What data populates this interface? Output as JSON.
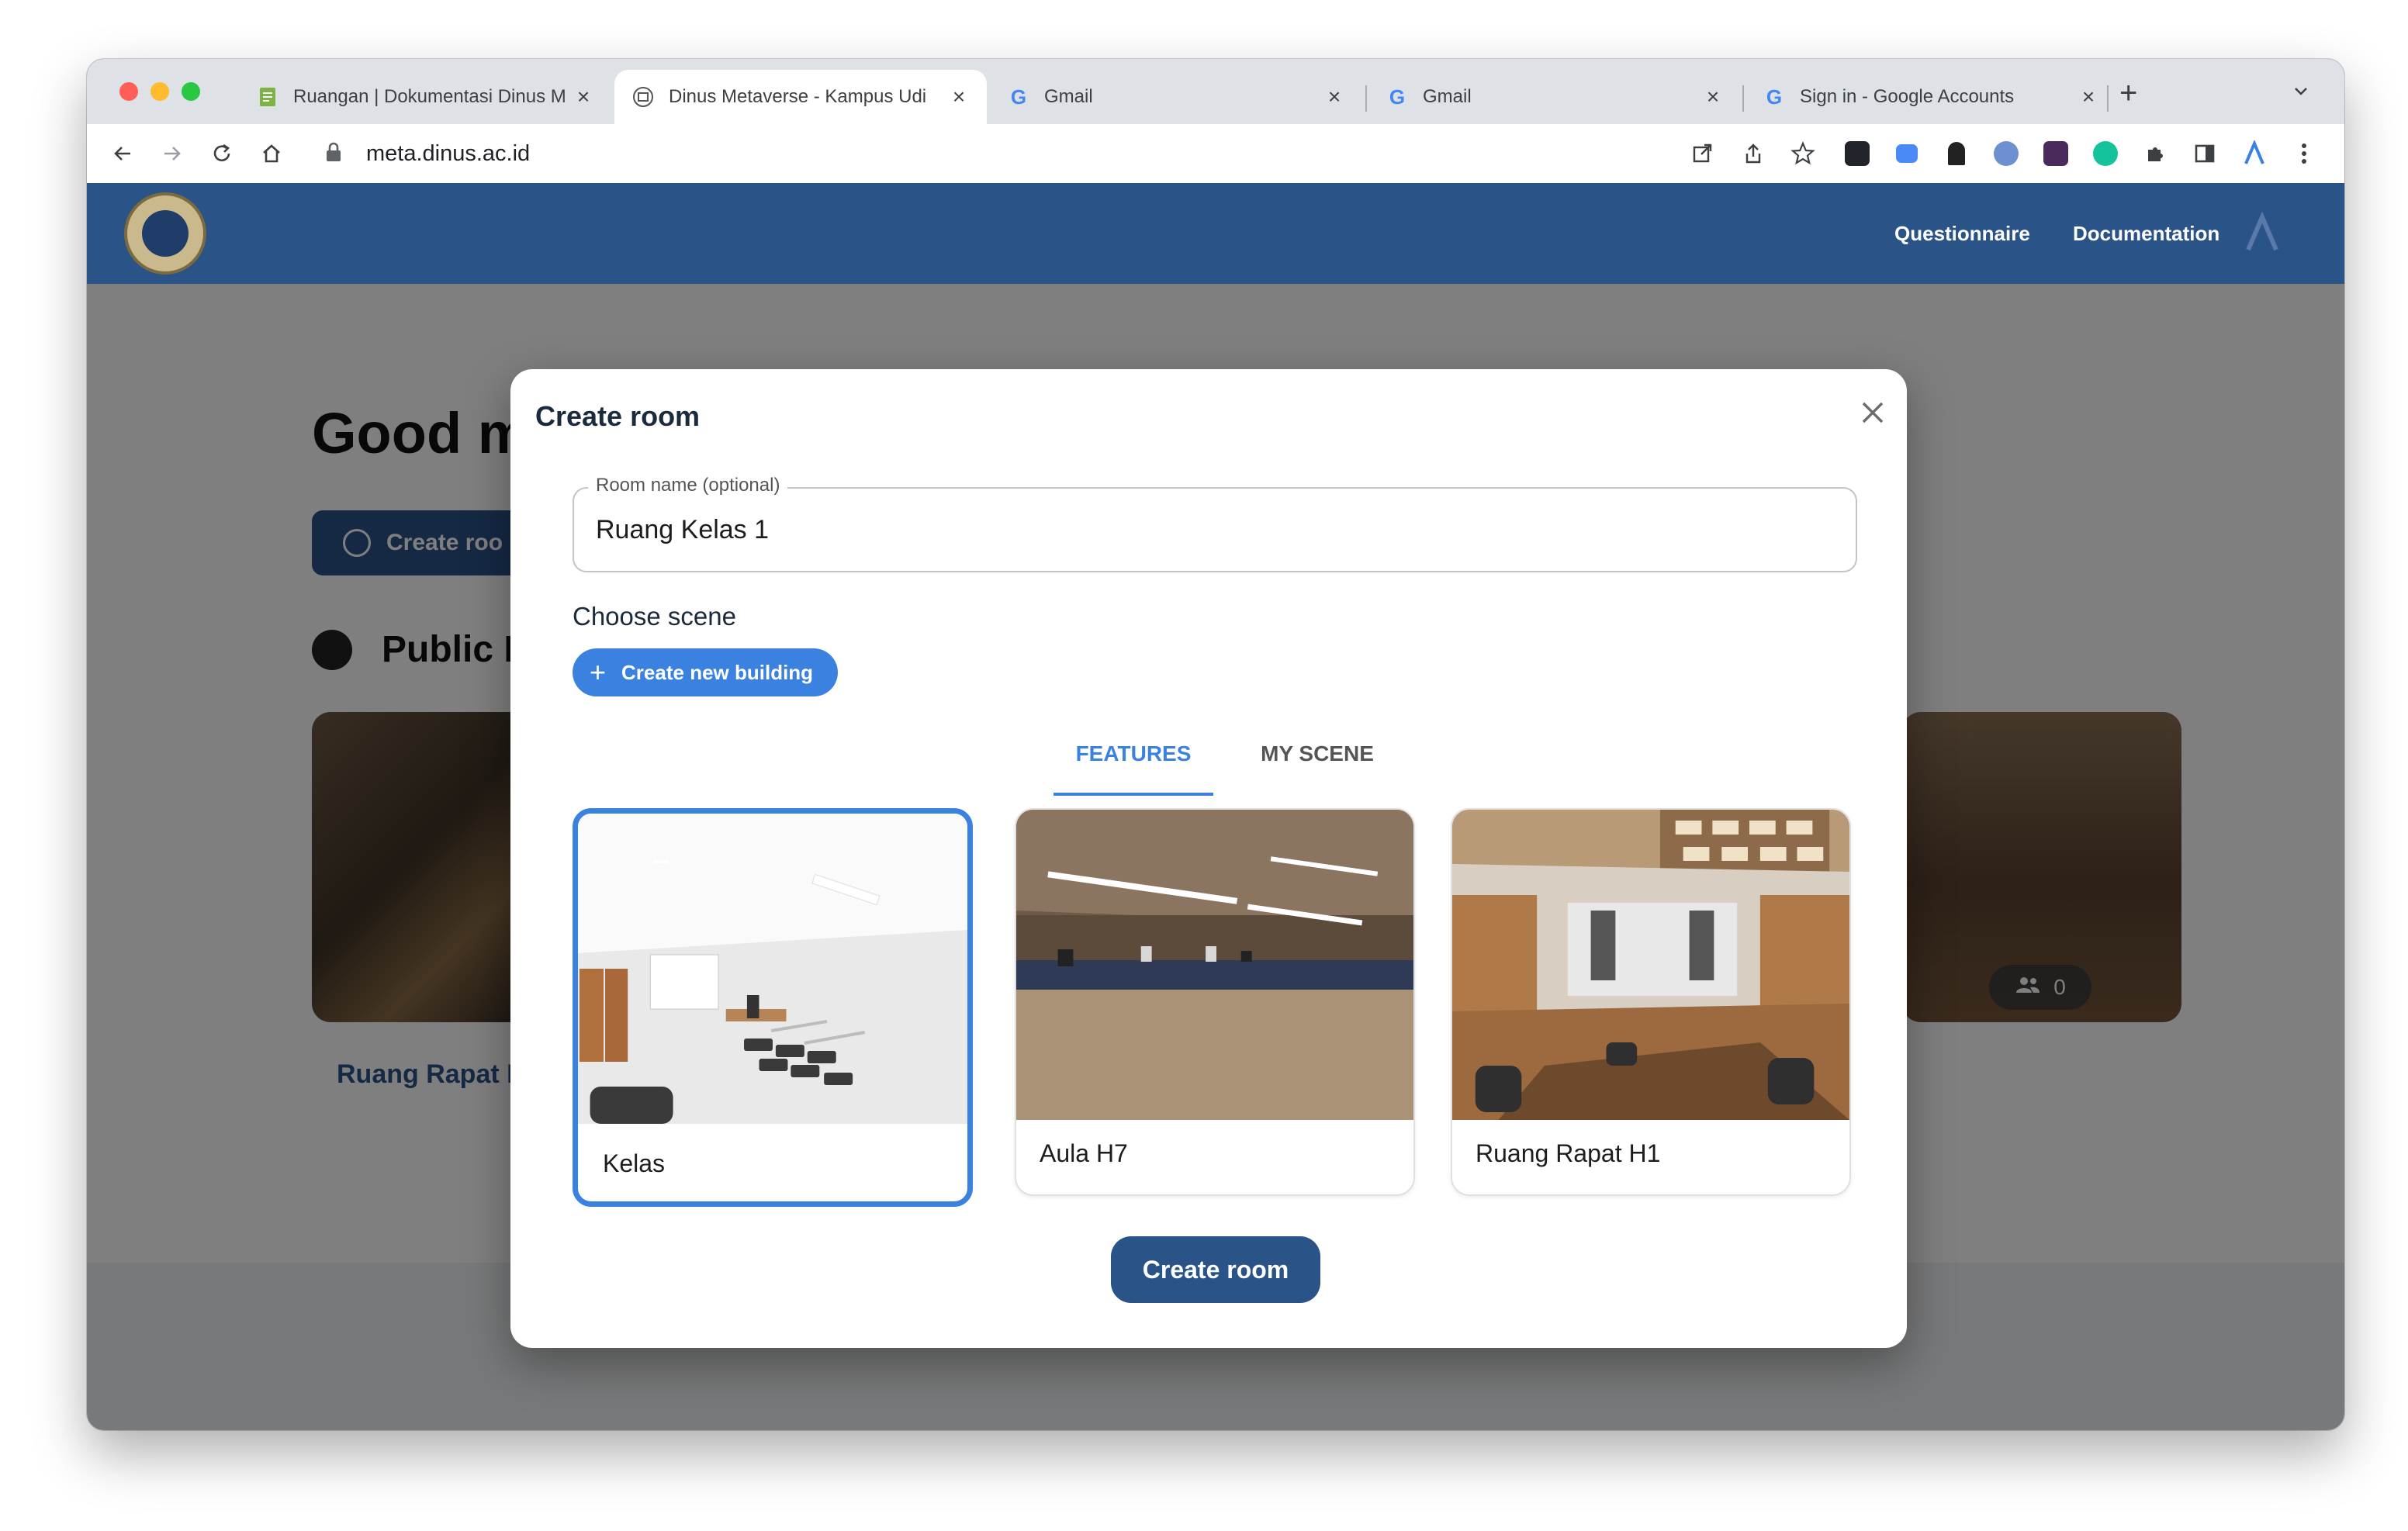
{
  "browser": {
    "tabs": [
      {
        "title": "Ruangan | Dokumentasi Dinus M",
        "icon": "docs-icon"
      },
      {
        "title": "Dinus Metaverse - Kampus Udi",
        "icon": "dinus-icon"
      },
      {
        "title": "Gmail",
        "icon": "google-icon"
      },
      {
        "title": "Gmail",
        "icon": "google-icon"
      },
      {
        "title": "Sign in - Google Accounts",
        "icon": "google-icon"
      }
    ],
    "active_tab": 1,
    "url": "meta.dinus.ac.id"
  },
  "site": {
    "nav": [
      "Questionnaire",
      "Documentation"
    ],
    "greeting": "Good m",
    "create_room_btn": "Create roo",
    "public_heading": "Public R",
    "room_card_caption": "Ruang Rapat I",
    "participant_count": "0"
  },
  "modal": {
    "title": "Create room",
    "room_name_label": "Room name (optional)",
    "room_name_value": "Ruang Kelas 1",
    "choose_scene_label": "Choose scene",
    "create_new_building": "Create new building",
    "tabs": {
      "features": "FEATURES",
      "my_scene": "MY SCENE"
    },
    "active_tab": "FEATURES",
    "scenes": [
      {
        "name": "Kelas",
        "selected": true
      },
      {
        "name": "Aula H7",
        "selected": false
      },
      {
        "name": "Ruang Rapat H1",
        "selected": false
      }
    ],
    "submit_label": "Create room"
  },
  "colors": {
    "brand_blue": "#2a5388",
    "accent_blue": "#3b82e0"
  }
}
